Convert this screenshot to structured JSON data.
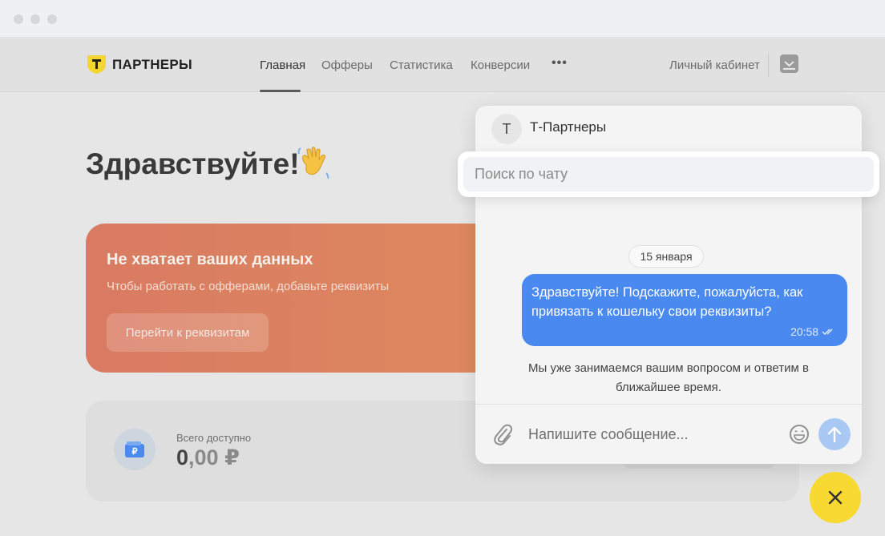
{
  "window": {
    "buttons": [
      "close",
      "minimize",
      "maximize"
    ]
  },
  "logo": {
    "text": "ПАРТНЕРЫ",
    "mark": "Т",
    "color": "#f5d530"
  },
  "nav": {
    "items": [
      {
        "label": "Главная",
        "active": true
      },
      {
        "label": "Офферы",
        "active": false
      },
      {
        "label": "Статистика",
        "active": false
      },
      {
        "label": "Конверсии",
        "active": false
      }
    ],
    "more": "•••",
    "cabinet": "Личный кабинет"
  },
  "greeting": {
    "text": "Здравствуйте!",
    "emoji_icon": "waving-hand-icon"
  },
  "banner": {
    "title": "Не хватает ваших данных",
    "subtitle": "Чтобы работать с офферами, добавьте реквизиты",
    "button": "Перейти к реквизитам"
  },
  "balance": {
    "label": "Всего доступно",
    "amount_int": "0",
    "amount_dec": ",00 ₽"
  },
  "chat": {
    "avatar_letter": "Т",
    "name": "Т-Партнеры",
    "search_placeholder": "Поиск по чату",
    "date": "15 января",
    "messages": [
      {
        "text": "Здравствуйте! Подскажите, пожалуйста, как привязать к кошельку свои реквизиты?",
        "time": "20:58",
        "status": "read"
      }
    ],
    "system_message": "Мы уже занимаемся вашим вопросом и ответим в ближайшее время.",
    "input_placeholder": "Напишите сообщение..."
  },
  "colors": {
    "accent_yellow": "#f7d931",
    "bubble_blue": "#4a8af0",
    "banner_orange": "#d97a62"
  }
}
